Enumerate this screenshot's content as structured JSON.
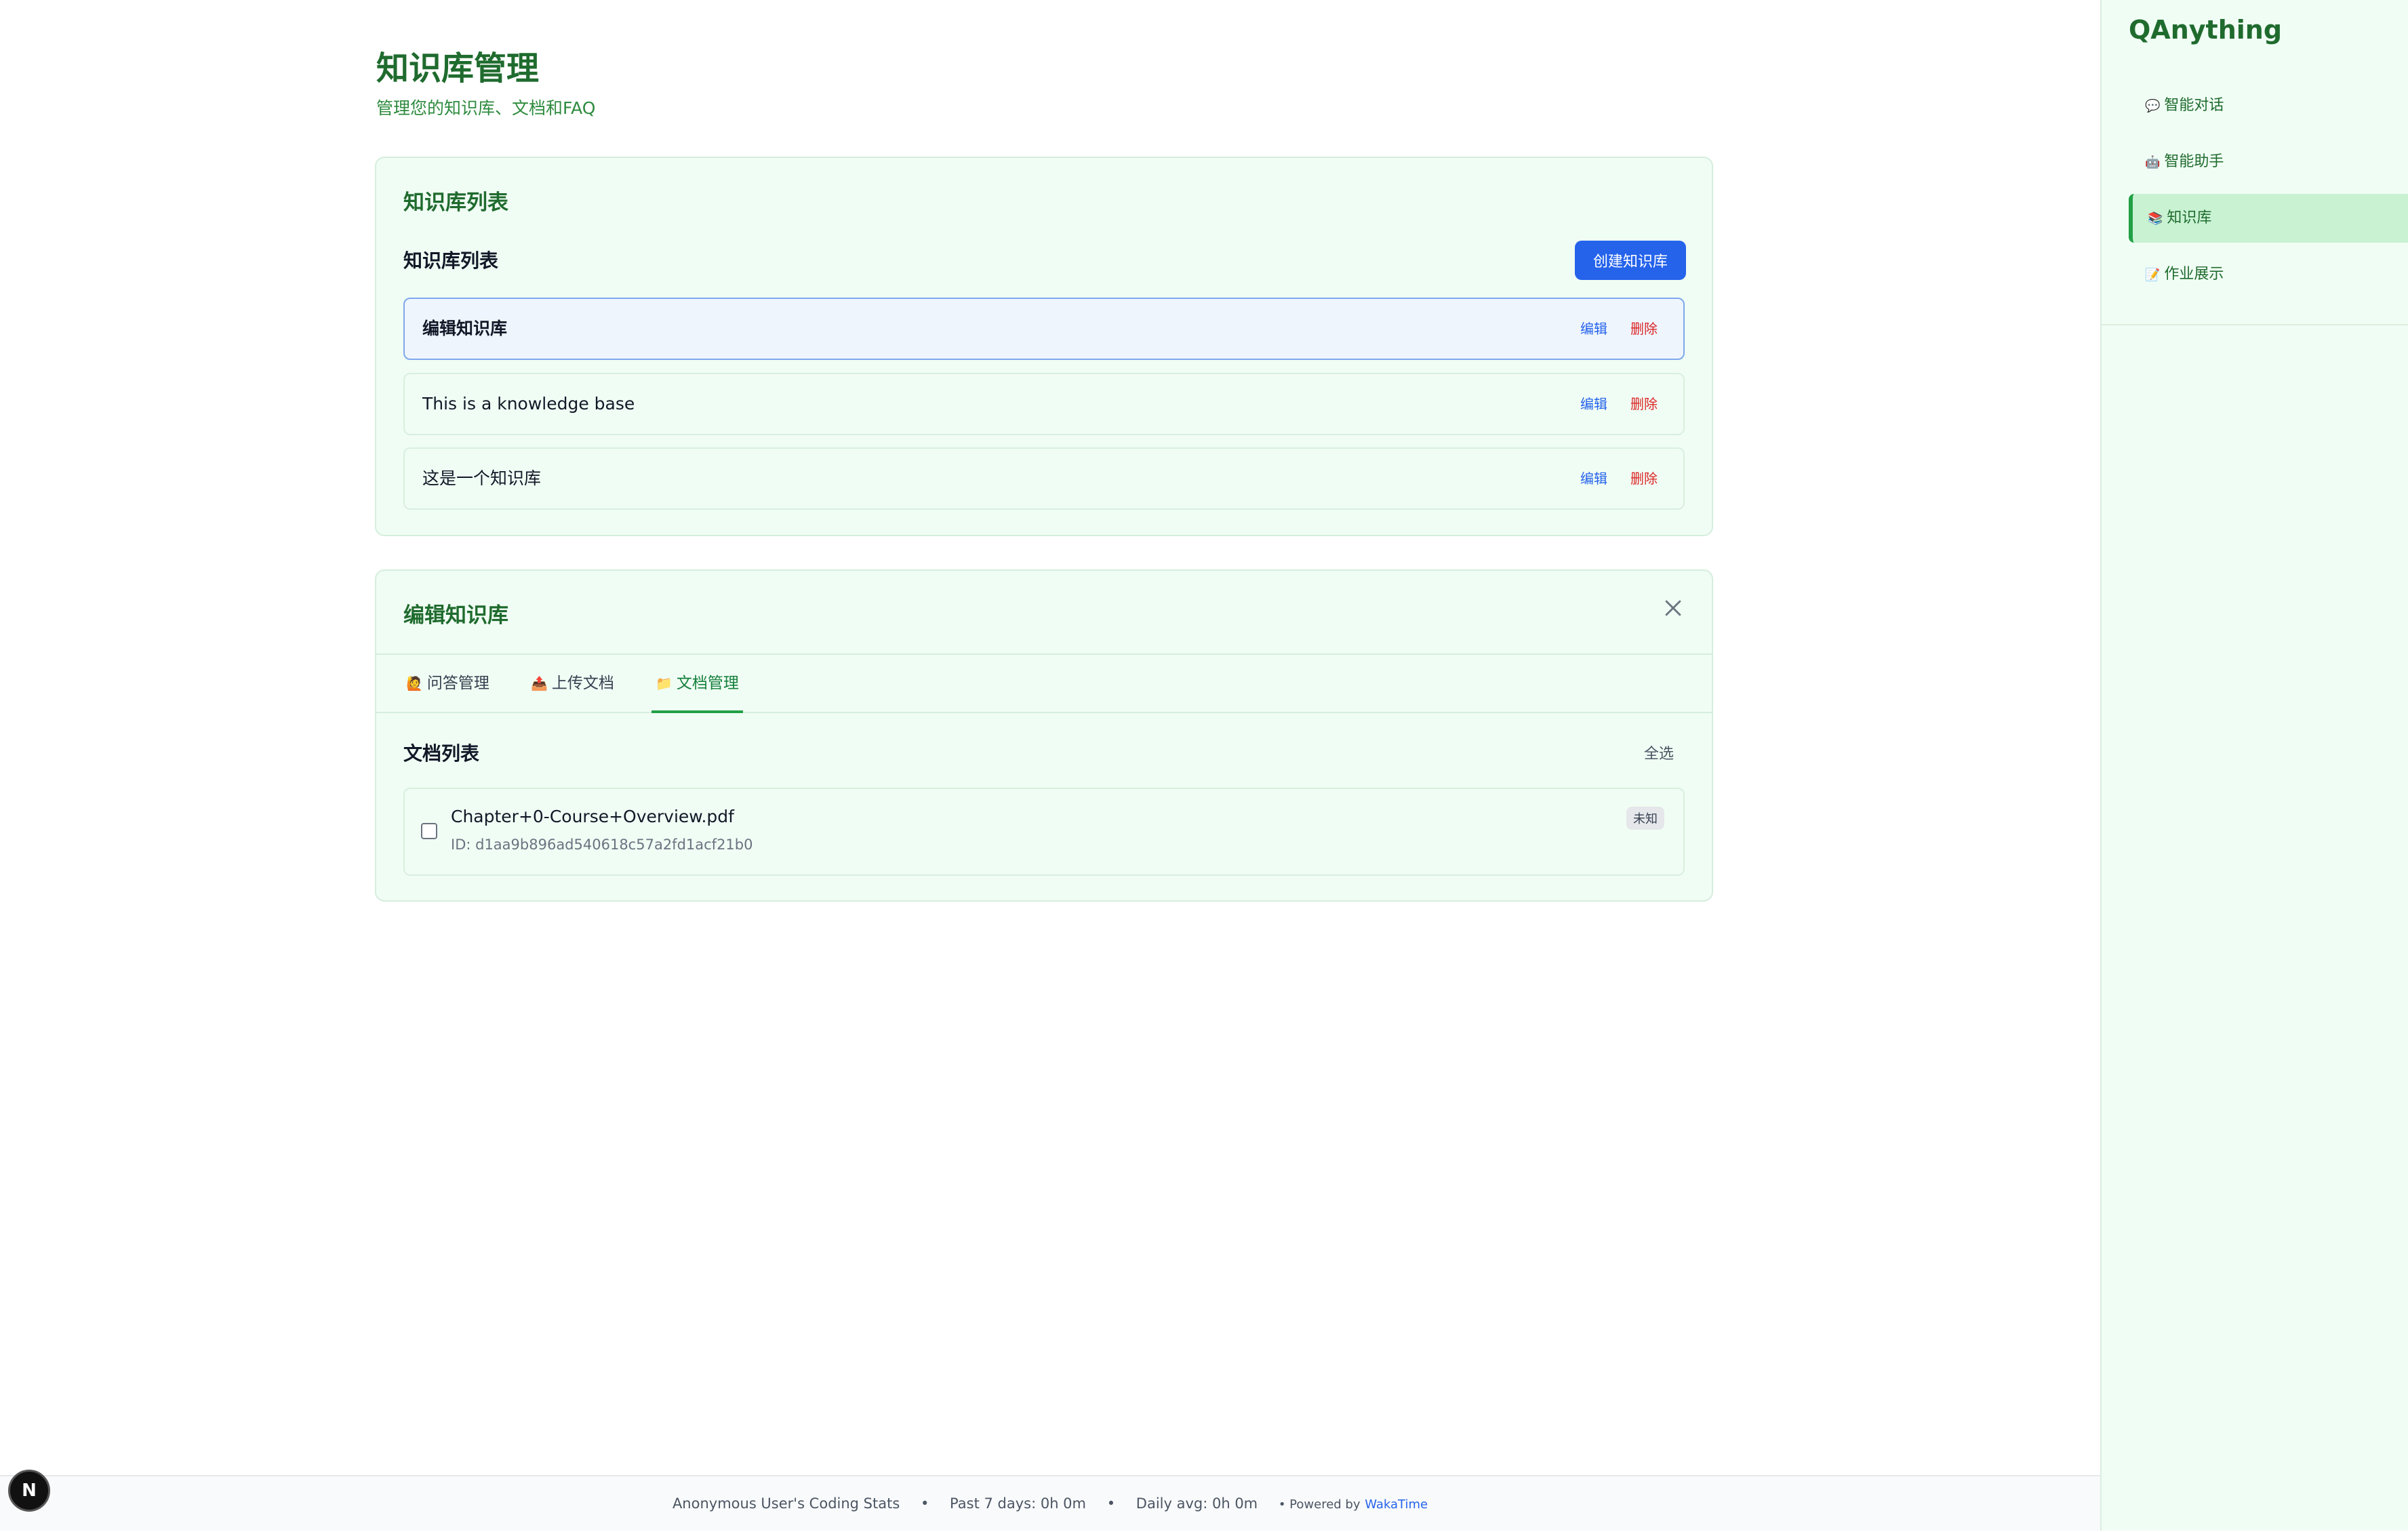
{
  "page": {
    "title": "知识库管理",
    "subtitle": "管理您的知识库、文档和FAQ"
  },
  "kb_list_card": {
    "title": "知识库列表",
    "heading": "知识库列表",
    "create_button": "创建知识库",
    "items": [
      {
        "name": "编辑知识库",
        "edit": "编辑",
        "delete": "删除",
        "selected": true
      },
      {
        "name": "This is a knowledge base",
        "edit": "编辑",
        "delete": "删除",
        "selected": false
      },
      {
        "name": "这是一个知识库",
        "edit": "编辑",
        "delete": "删除",
        "selected": false
      }
    ]
  },
  "edit_card": {
    "title": "编辑知识库",
    "tabs": [
      {
        "icon": "🙋",
        "label": "问答管理",
        "active": false
      },
      {
        "icon": "📤",
        "label": "上传文档",
        "active": false
      },
      {
        "icon": "📁",
        "label": "文档管理",
        "active": true
      }
    ],
    "doc_list_heading": "文档列表",
    "select_all": "全选",
    "documents": [
      {
        "name": "Chapter+0-Course+Overview.pdf",
        "id": "ID: d1aa9b896ad540618c57a2fd1acf21b0",
        "status": "未知",
        "checked": false
      }
    ]
  },
  "sidebar": {
    "brand": "QAnything",
    "items": [
      {
        "icon": "💬",
        "label": "智能对话",
        "active": false
      },
      {
        "icon": "🤖",
        "label": "智能助手",
        "active": false
      },
      {
        "icon": "📚",
        "label": "知识库",
        "active": true
      },
      {
        "icon": "📝",
        "label": "作业展示",
        "active": false
      }
    ]
  },
  "footer": {
    "stats_title": "Anonymous User's Coding Stats",
    "separator": "•",
    "past_7_days": "Past 7 days: 0h 0m",
    "daily_avg": "Daily avg: 0h 0m",
    "powered_by": "• Powered by",
    "wakatime": "WakaTime"
  },
  "badge": {
    "letter": "N"
  },
  "colors": {
    "primary_green": "#1f6b2e",
    "accent_green": "#22a046",
    "card_bg": "#f0fdf4",
    "button_blue": "#2563eb",
    "delete_red": "#dc2626"
  }
}
